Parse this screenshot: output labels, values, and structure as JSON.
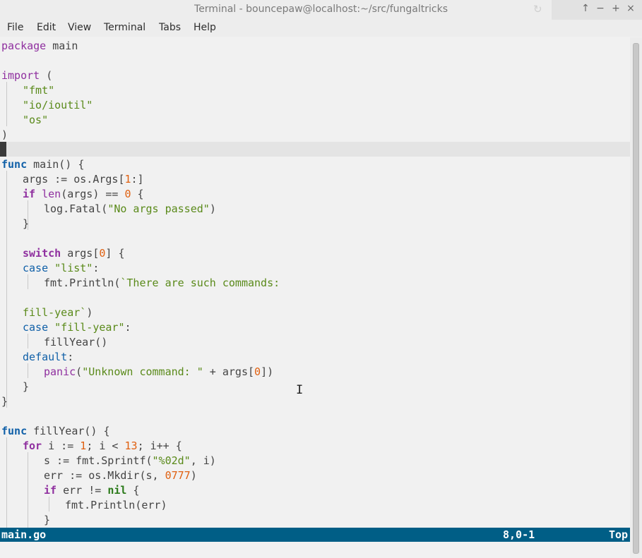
{
  "window": {
    "title": "Terminal - bouncepaw@localhost:~/src/fungaltricks",
    "buttons": [
      "↑",
      "−",
      "+",
      "×"
    ],
    "refresh_icon": "↻"
  },
  "menu": [
    "File",
    "Edit",
    "View",
    "Terminal",
    "Tabs",
    "Help"
  ],
  "editor": {
    "code": {
      "l1": [
        "package",
        " main"
      ],
      "l3": [
        "import",
        " ("
      ],
      "l4": "\"fmt\"",
      "l5": "\"io/ioutil\"",
      "l6": "\"os\"",
      "l7": ")",
      "l9": [
        "func",
        " main() {"
      ],
      "l10": [
        "args := os.Args[",
        "1",
        ":]"
      ],
      "l11": [
        "if",
        " ",
        "len",
        "(args) == ",
        "0",
        " {"
      ],
      "l12": [
        "log.Fatal(",
        "\"No args passed\"",
        ")"
      ],
      "l13": "}",
      "l15": [
        "switch",
        " args[",
        "0",
        "] {"
      ],
      "l16": [
        "case",
        " ",
        "\"list\"",
        ":"
      ],
      "l17": [
        "fmt.Println(",
        "`There are such commands:"
      ],
      "l19": [
        "fill-year`",
        ")"
      ],
      "l20": [
        "case",
        " ",
        "\"fill-year\"",
        ":"
      ],
      "l21": "fillYear()",
      "l22": [
        "default",
        ":"
      ],
      "l23": [
        "panic",
        "(",
        "\"Unknown command: \"",
        " + args[",
        "0",
        "])"
      ],
      "l24": "}",
      "l25": "}",
      "l27": [
        "func",
        " fillYear() {"
      ],
      "l28": [
        "for",
        " i := ",
        "1",
        "; i < ",
        "13",
        "; i++ {"
      ],
      "l29": [
        "s := fmt.Sprintf(",
        "\"%02d\"",
        ", i)"
      ],
      "l30": [
        "err := os.Mkdir(s, ",
        "0777",
        ")"
      ],
      "l31": [
        "if",
        " err != ",
        "nil",
        " {"
      ],
      "l32": "fmt.Println(err)",
      "l33": "}"
    }
  },
  "status": {
    "file": "main.go",
    "position": "8,0-1",
    "scroll": "Top"
  },
  "colors": {
    "status_bg": "#005e86",
    "keyword": "#8f2f9f",
    "func_keyword": "#1060a8",
    "string": "#5a8a1a",
    "number": "#e06010"
  }
}
